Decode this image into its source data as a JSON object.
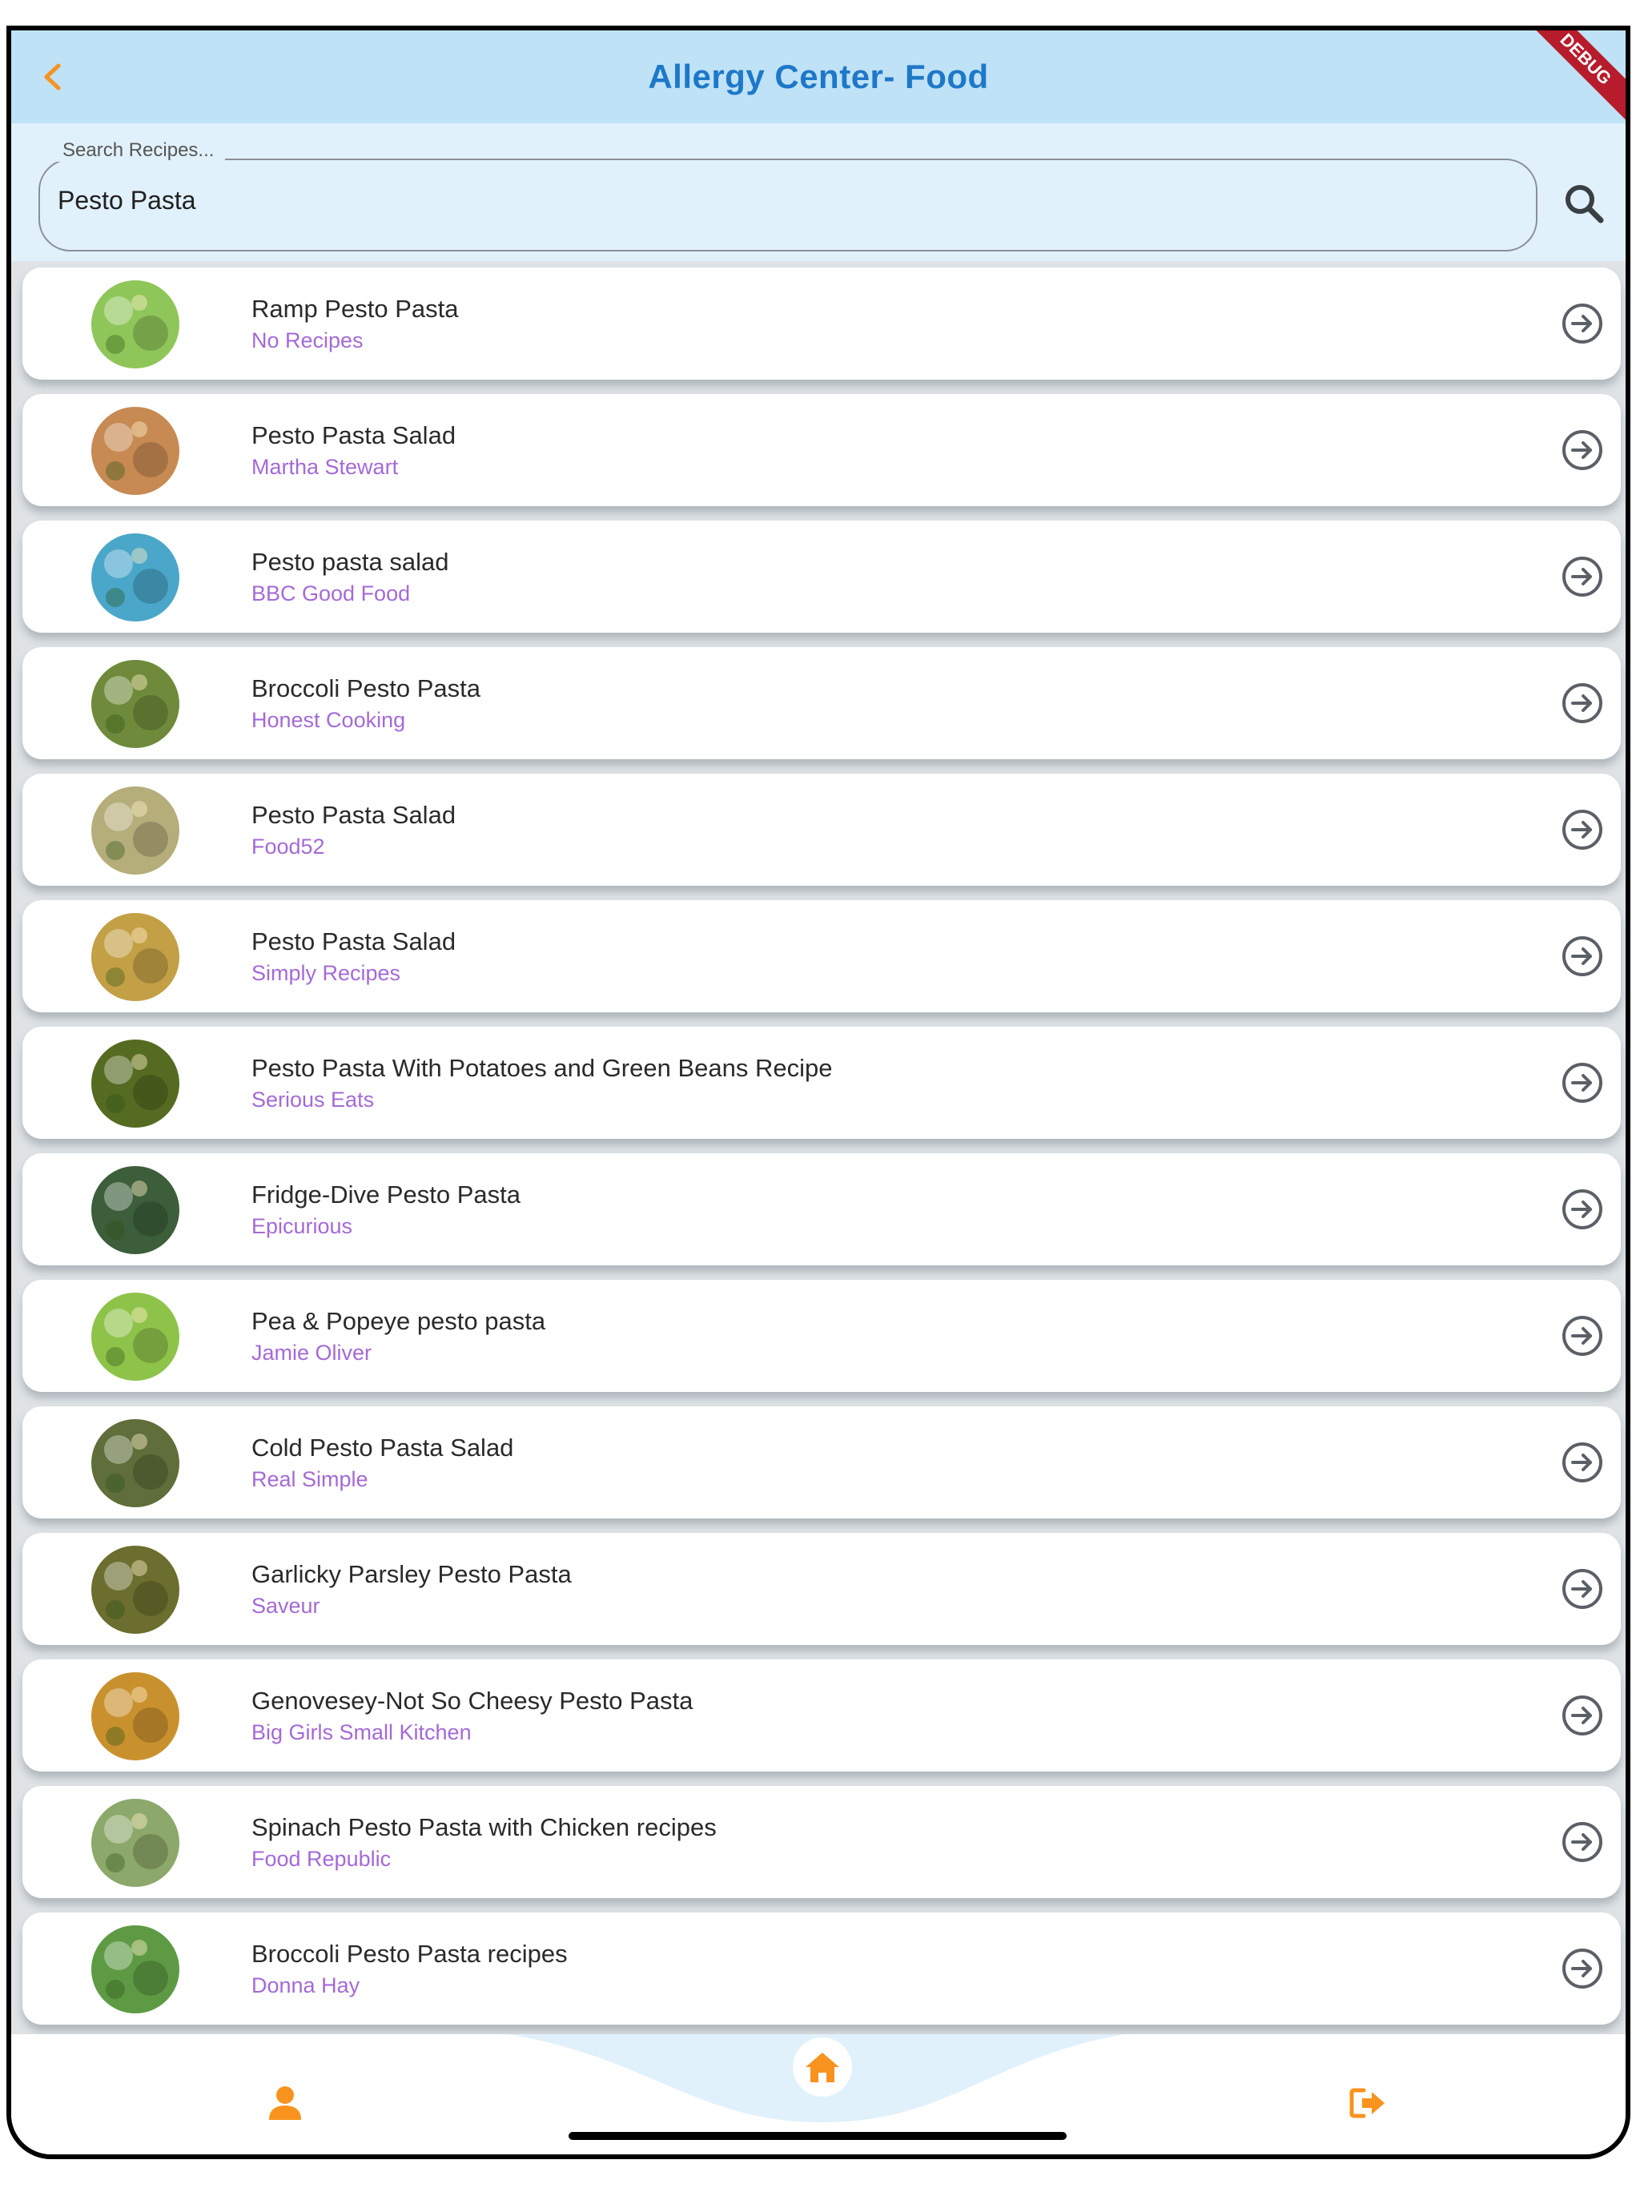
{
  "app": {
    "title": "Allergy Center- Food",
    "debug_ribbon": "DEBUG",
    "accent_color": "#f7931e",
    "title_color": "#1e78c8",
    "appbar_color": "#bfe2f6",
    "source_color": "#a46ad6"
  },
  "search": {
    "label": "Search Recipes...",
    "value": "Pesto Pasta"
  },
  "recipes": [
    {
      "title": "Ramp Pesto Pasta",
      "source": "No Recipes",
      "thumb": "#8fc65a"
    },
    {
      "title": "Pesto Pasta Salad",
      "source": "Martha Stewart",
      "thumb": "#c78a52"
    },
    {
      "title": "Pesto pasta salad",
      "source": "BBC Good Food",
      "thumb": "#4aa7c9"
    },
    {
      "title": "Broccoli Pesto Pasta",
      "source": "Honest Cooking",
      "thumb": "#6f8a3a"
    },
    {
      "title": "Pesto Pasta Salad",
      "source": "Food52",
      "thumb": "#b5ad7a"
    },
    {
      "title": "Pesto Pasta Salad",
      "source": "Simply Recipes",
      "thumb": "#c3a046"
    },
    {
      "title": "Pesto Pasta With Potatoes and Green Beans Recipe",
      "source": "Serious Eats",
      "thumb": "#556b22"
    },
    {
      "title": "Fridge-Dive Pesto Pasta",
      "source": "Epicurious",
      "thumb": "#3c5e3a"
    },
    {
      "title": "Pea & Popeye pesto pasta",
      "source": "Jamie Oliver",
      "thumb": "#8ec34a"
    },
    {
      "title": "Cold Pesto Pasta Salad",
      "source": "Real Simple",
      "thumb": "#5f6e3a"
    },
    {
      "title": "Garlicky Parsley Pesto Pasta",
      "source": "Saveur",
      "thumb": "#6b6e2e"
    },
    {
      "title": "Genovesey-Not So Cheesy Pesto Pasta",
      "source": "Big Girls Small Kitchen",
      "thumb": "#c9912e"
    },
    {
      "title": "Spinach Pesto Pasta with Chicken recipes",
      "source": "Food Republic",
      "thumb": "#8ca86a"
    },
    {
      "title": "Broccoli Pesto Pasta recipes",
      "source": "Donna Hay",
      "thumb": "#5e9a44"
    },
    {
      "title": "",
      "source": "",
      "thumb": "#c8b070"
    }
  ],
  "nav": {
    "profile_icon": "person-icon",
    "home_icon": "home-icon",
    "logout_icon": "logout-icon"
  }
}
